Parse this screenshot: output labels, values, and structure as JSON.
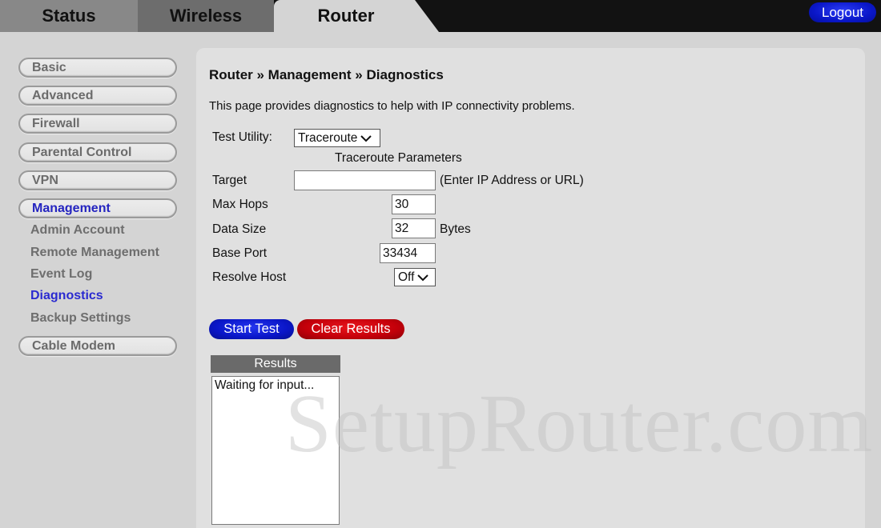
{
  "header": {
    "tabs": [
      {
        "label": "Status",
        "active": false
      },
      {
        "label": "Wireless",
        "active": false
      },
      {
        "label": "Router",
        "active": true
      }
    ],
    "logout_label": "Logout"
  },
  "sidebar": {
    "items": [
      {
        "label": "Basic",
        "active": false
      },
      {
        "label": "Advanced",
        "active": false
      },
      {
        "label": "Firewall",
        "active": false
      },
      {
        "label": "Parental Control",
        "active": false
      },
      {
        "label": "VPN",
        "active": false
      },
      {
        "label": "Management",
        "active": true
      },
      {
        "label": "Cable Modem",
        "active": false
      }
    ],
    "management_subitems": [
      {
        "label": "Admin Account",
        "active": false
      },
      {
        "label": "Remote Management",
        "active": false
      },
      {
        "label": "Event Log",
        "active": false
      },
      {
        "label": "Diagnostics",
        "active": true
      },
      {
        "label": "Backup Settings",
        "active": false
      }
    ]
  },
  "main": {
    "breadcrumb": "Router » Management » Diagnostics",
    "intro": "This page provides diagnostics to help with IP connectivity problems.",
    "test_utility": {
      "label": "Test Utility:",
      "value": "Traceroute"
    },
    "params_title": "Traceroute Parameters",
    "target": {
      "label": "Target",
      "value": "",
      "hint": "(Enter IP Address or URL)"
    },
    "max_hops": {
      "label": "Max Hops",
      "value": "30"
    },
    "data_size": {
      "label": "Data Size",
      "value": "32",
      "unit": "Bytes"
    },
    "base_port": {
      "label": "Base Port",
      "value": "33434"
    },
    "resolve_host": {
      "label": "Resolve Host",
      "value": "Off"
    },
    "start_test_label": "Start Test",
    "clear_results_label": "Clear Results",
    "results_title": "Results",
    "results_text": "Waiting for input..."
  },
  "watermark": "SetupRouter.com",
  "colors": {
    "active_link": "#2a2ad0",
    "logout_blue": "#0a17c9",
    "start_blue": "#0a16c8",
    "clear_red": "#c4000a"
  }
}
